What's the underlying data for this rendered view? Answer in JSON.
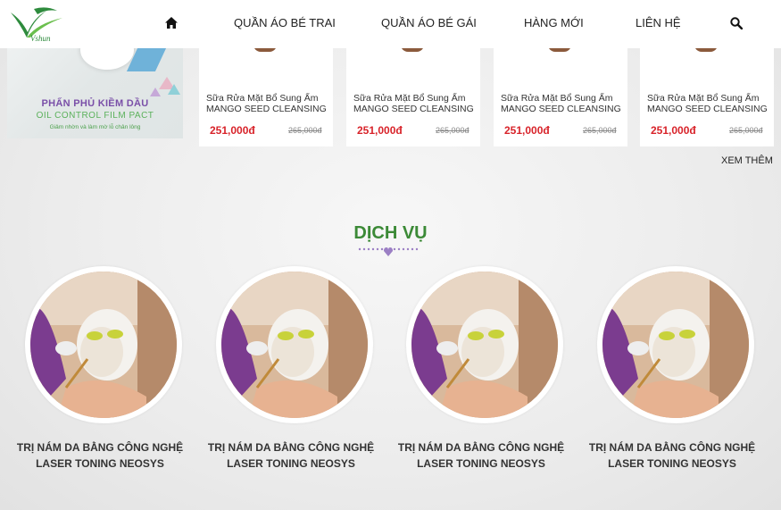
{
  "header": {
    "logo_text": "Vshun",
    "nav": [
      "QUẦN ÁO BÉ TRAI",
      "QUẦN ÁO BÉ GÁI",
      "HÀNG MỚI",
      "LIÊN HỆ"
    ]
  },
  "banner": {
    "title": "PHẤN PHỦ KIỀM DẦU",
    "subtitle": "OIL CONTROL FILM PACT",
    "desc": "Giảm nhờn và làm mờ lỗ chân lông"
  },
  "products": [
    {
      "name": "Sữa Rửa Mặt Bổ Sung Ẩm MANGO SEED CLEANSING",
      "price": "251,000đ",
      "old_price": "265,000đ"
    },
    {
      "name": "Sữa Rửa Mặt Bổ Sung Ẩm MANGO SEED CLEANSING",
      "price": "251,000đ",
      "old_price": "265,000đ"
    },
    {
      "name": "Sữa Rửa Mặt Bổ Sung Ẩm MANGO SEED CLEANSING",
      "price": "251,000đ",
      "old_price": "265,000đ"
    },
    {
      "name": "Sữa Rửa Mặt Bổ Sung Ẩm MANGO SEED CLEANSING",
      "price": "251,000đ",
      "old_price": "265,000đ"
    }
  ],
  "see_more": "XEM THÊM",
  "services_section": {
    "title": "DỊCH VỤ",
    "items": [
      {
        "title": "TRỊ NÁM DA BẰNG CÔNG NGHỆ LASER TONING NEOSYS"
      },
      {
        "title": "TRỊ NÁM DA BẰNG CÔNG NGHỆ LASER TONING NEOSYS"
      },
      {
        "title": "TRỊ NÁM DA BẰNG CÔNG NGHỆ LASER TONING NEOSYS"
      },
      {
        "title": "TRỊ NÁM DA BẰNG CÔNG NGHỆ LASER TONING NEOSYS"
      }
    ]
  },
  "colors": {
    "accent_green": "#3c8a37",
    "price_red": "#d8232a",
    "divider_purple": "#9b7fc4"
  },
  "icons": [
    "home-icon",
    "search-icon"
  ]
}
